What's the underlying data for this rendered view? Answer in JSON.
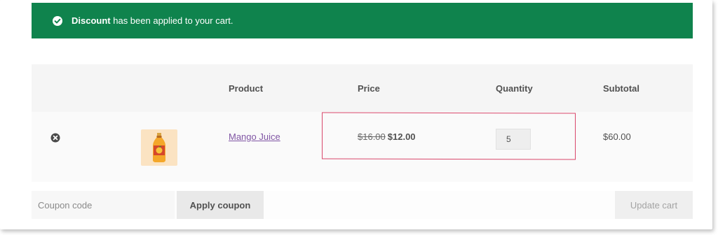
{
  "notice": {
    "bold_text": "Discount",
    "rest_text": " has been applied to your cart.",
    "icon": "check-circle-icon",
    "color": "#0f834d"
  },
  "table": {
    "headers": {
      "product": "Product",
      "price": "Price",
      "quantity": "Quantity",
      "subtotal": "Subtotal"
    },
    "rows": [
      {
        "remove_icon": "remove-circle-icon",
        "thumbnail_icon": "mango-juice-bottle-icon",
        "product_name": "Mango Juice",
        "price_old": "$16.00",
        "price_new": "$12.00",
        "quantity": "5",
        "subtotal": "$60.00"
      }
    ]
  },
  "actions": {
    "coupon_placeholder": "Coupon code",
    "apply_label": "Apply coupon",
    "update_label": "Update cart"
  },
  "colors": {
    "link": "#8055a4",
    "highlight_border": "#d9476b"
  }
}
